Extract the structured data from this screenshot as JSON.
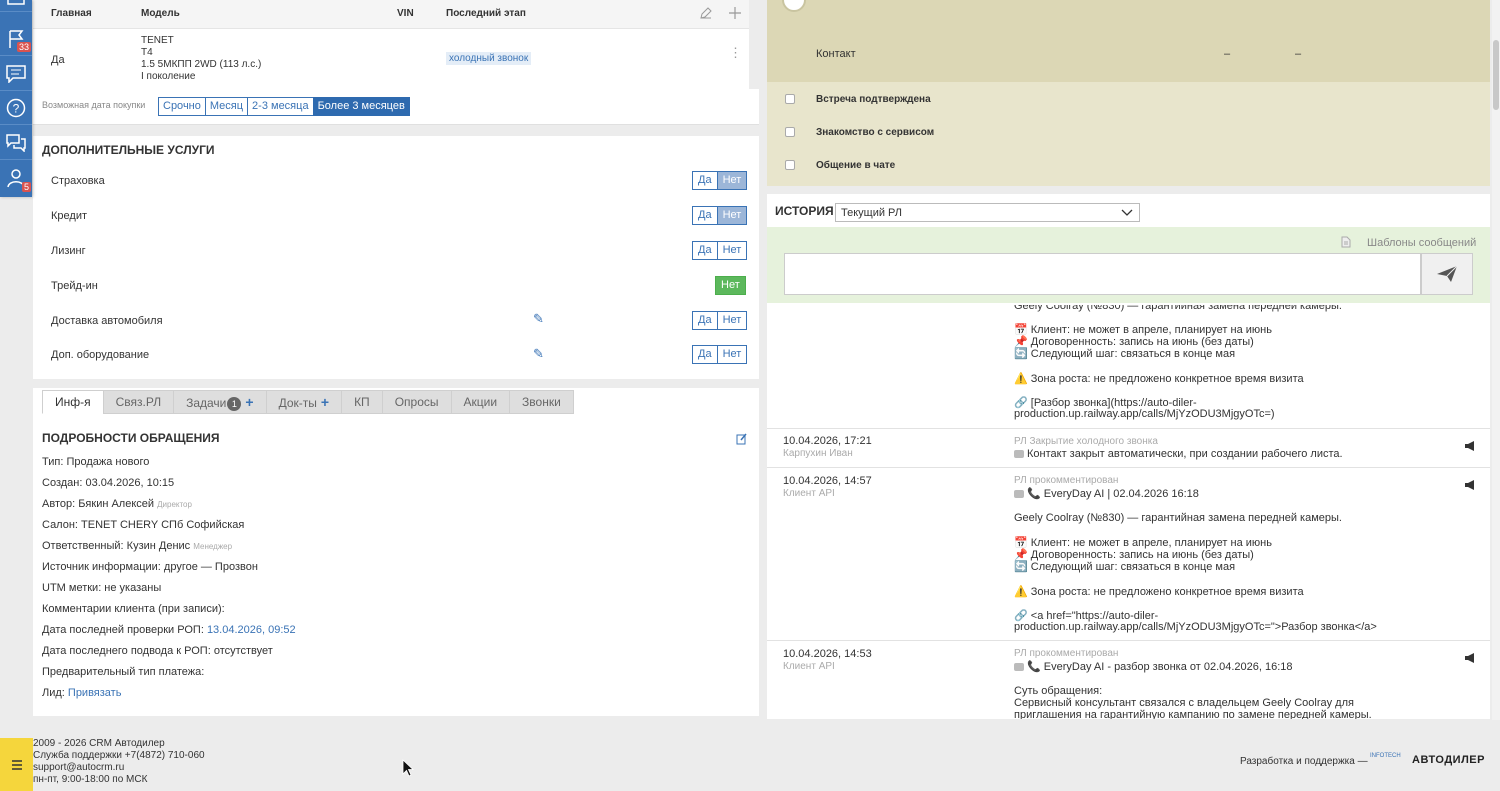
{
  "sidebar": {
    "badges": {
      "flag": "33",
      "user": "5"
    }
  },
  "model_table": {
    "headers": [
      "Главная",
      "Модель",
      "VIN",
      "Последний этап"
    ],
    "row": {
      "main": "Да",
      "model_lines": [
        "TENET",
        "T4",
        "1.5 5МКПП 2WD (113 л.с.)",
        "I поколение"
      ],
      "stage": "холодный звонок"
    }
  },
  "purchase": {
    "label": "Возможная дата покупки",
    "options": [
      "Срочно",
      "Месяц",
      "2-3 месяца",
      "Более 3 месяцев"
    ],
    "selected": 3
  },
  "services": {
    "title": "ДОПОЛНИТЕЛЬНЫЕ УСЛУГИ",
    "yes": "Да",
    "no": "Нет",
    "items": [
      {
        "label": "Страховка"
      },
      {
        "label": "Кредит"
      },
      {
        "label": "Лизинг"
      },
      {
        "label": "Трейд-ин"
      },
      {
        "label": "Доставка автомобиля"
      },
      {
        "label": "Доп. оборудование"
      }
    ]
  },
  "tabs": [
    {
      "label": "Инф-я"
    },
    {
      "label": "Связ.РЛ"
    },
    {
      "label": "Задачи",
      "badge": "1"
    },
    {
      "label": "Док-ты"
    },
    {
      "label": "КП"
    },
    {
      "label": "Опросы"
    },
    {
      "label": "Акции"
    },
    {
      "label": "Звонки"
    }
  ],
  "details": {
    "title": "ПОДРОБНОСТИ ОБРАЩЕНИЯ",
    "type": "Тип: Продажа нового",
    "created": "Создан: 03.04.2026, 10:15",
    "author": "Автор: Бякин Алексей",
    "author_role": "Директор",
    "salon": "Салон: TENET CHERY СПб Софийская",
    "responsible": "Ответственный: Кузин Денис",
    "responsible_role": "Менеджер",
    "source": "Источник информации: другое — Прозвон",
    "utm": "UTM метки: не указаны",
    "comments": "Комментарии клиента (при записи):",
    "rop_check_label": "Дата последней проверки РОП: ",
    "rop_check_value": "13.04.2026, 09:52",
    "rop_summary": "Дата последнего подвода к РОП: отсутствует",
    "payment": "Предварительный тип платежа:",
    "lead_label": "Лид: ",
    "lead_link": "Привязать"
  },
  "right_top": {
    "contact": "Контакт",
    "dash1": "–",
    "dash2": "–",
    "checks": [
      "Встреча подтверждена",
      "Знакомство с сервисом",
      "Общение в чате"
    ]
  },
  "history": {
    "title": "ИСТОРИЯ",
    "select": "Текущий РЛ",
    "templates": "Шаблоны сообщений",
    "top_lines": {
      "cut": "Geely Coolray (№830) — гарантийная замена передней камеры.",
      "client": "Клиент: не может в апреле, планирует на июнь",
      "deal": "Договоренность: запись на июнь (без даты)",
      "next": "Следующий шаг: связаться в конце мая",
      "growth": "Зона роста: не предложено конкретное время визита",
      "link1": "[Разбор звонка](https://auto-diler-",
      "link2": "production.up.railway.app/calls/MjYzODU3MjgyOTc=)"
    },
    "entry1": {
      "ts": "10.04.2026, 17:21",
      "author": "Карпухин Иван",
      "type": "РЛ Закрытие холодного звонка",
      "text": "Контакт закрыт автоматически, при создании рабочего листа."
    },
    "entry2": {
      "ts": "10.04.2026, 14:57",
      "author": "Клиент API",
      "type": "РЛ прокомментирован",
      "head": "EveryDay AI | 02.04.2026 16:18",
      "car": "Geely Coolray (№830) — гарантийная замена передней камеры.",
      "client": "Клиент: не может в апреле, планирует на июнь",
      "deal": "Договоренность: запись на июнь (без даты)",
      "next": "Следующий шаг: связаться в конце мая",
      "growth": "Зона роста: не предложено конкретное время визита",
      "link1": "<a href=\"https://auto-diler-",
      "link2": "production.up.railway.app/calls/MjYzODU3MjgyOTc=\">Разбор звонка</a>"
    },
    "entry3": {
      "ts": "10.04.2026, 14:53",
      "author": "Клиент API",
      "type": "РЛ прокомментирован",
      "head": "EveryDay AI - разбор звонка от 02.04.2026, 16:18",
      "s1": "Суть обращения:",
      "s2": "Сервисный консультант связался с владельцем Geely Coolray для",
      "s3": "приглашения на гарантийную кампанию по замене передней камеры."
    }
  },
  "footer": {
    "copy": "2009 - 2026 CRM Автодилер",
    "support": "Служба поддержки +7(4872) 710-060",
    "email": "support@autocrm.ru",
    "hours": "пн-пт, 9:00-18:00 по МСК",
    "dev": "Разработка и поддержка —",
    "logo_small": "INFOTECH",
    "logo": "АВТОДИЛЕР"
  }
}
